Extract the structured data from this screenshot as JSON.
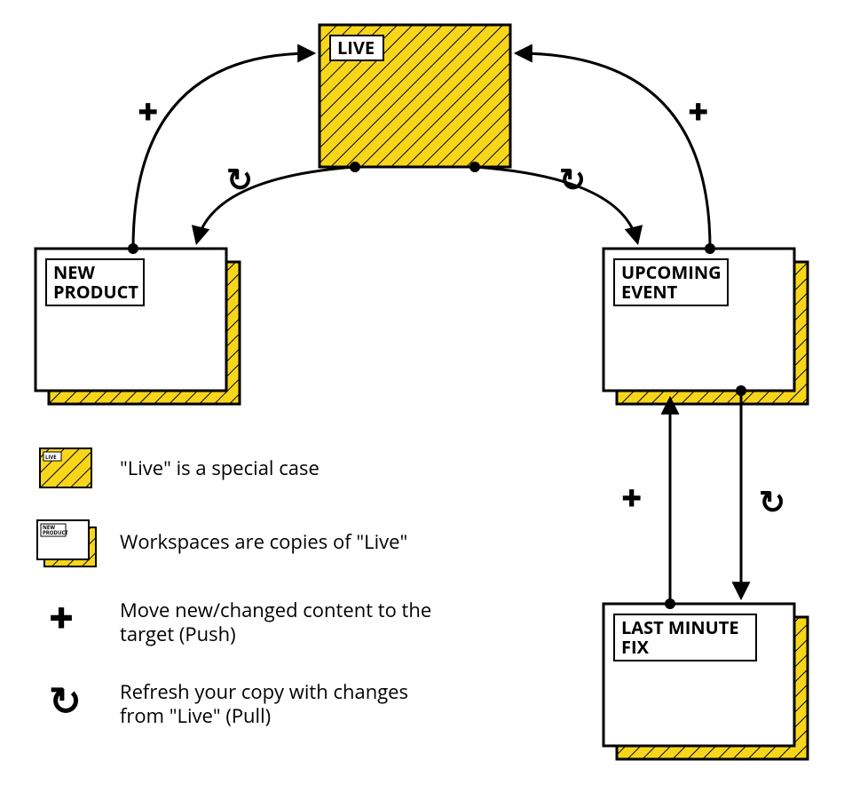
{
  "nodes": {
    "live": {
      "label": "LIVE"
    },
    "new_product": {
      "label_line1": "NEW",
      "label_line2": "PRODUCT"
    },
    "upcoming_event": {
      "label_line1": "UPCOMING",
      "label_line2": "EVENT"
    },
    "last_minute_fix": {
      "label_line1": "LAST MINUTE",
      "label_line2": "FIX"
    }
  },
  "symbols": {
    "plus": "+",
    "refresh": "↻"
  },
  "legend": {
    "live": "\"Live\" is a special case",
    "workspace": "Workspaces are copies of \"Live\"",
    "push_line1": "Move new/changed content to the",
    "push_line2": "target (Push)",
    "pull_line1": "Refresh your copy with changes",
    "pull_line2": "from \"Live\" (Pull)",
    "mini_live": "LIVE",
    "mini_ws_line1": "NEW",
    "mini_ws_line2": "PRODUCT"
  }
}
